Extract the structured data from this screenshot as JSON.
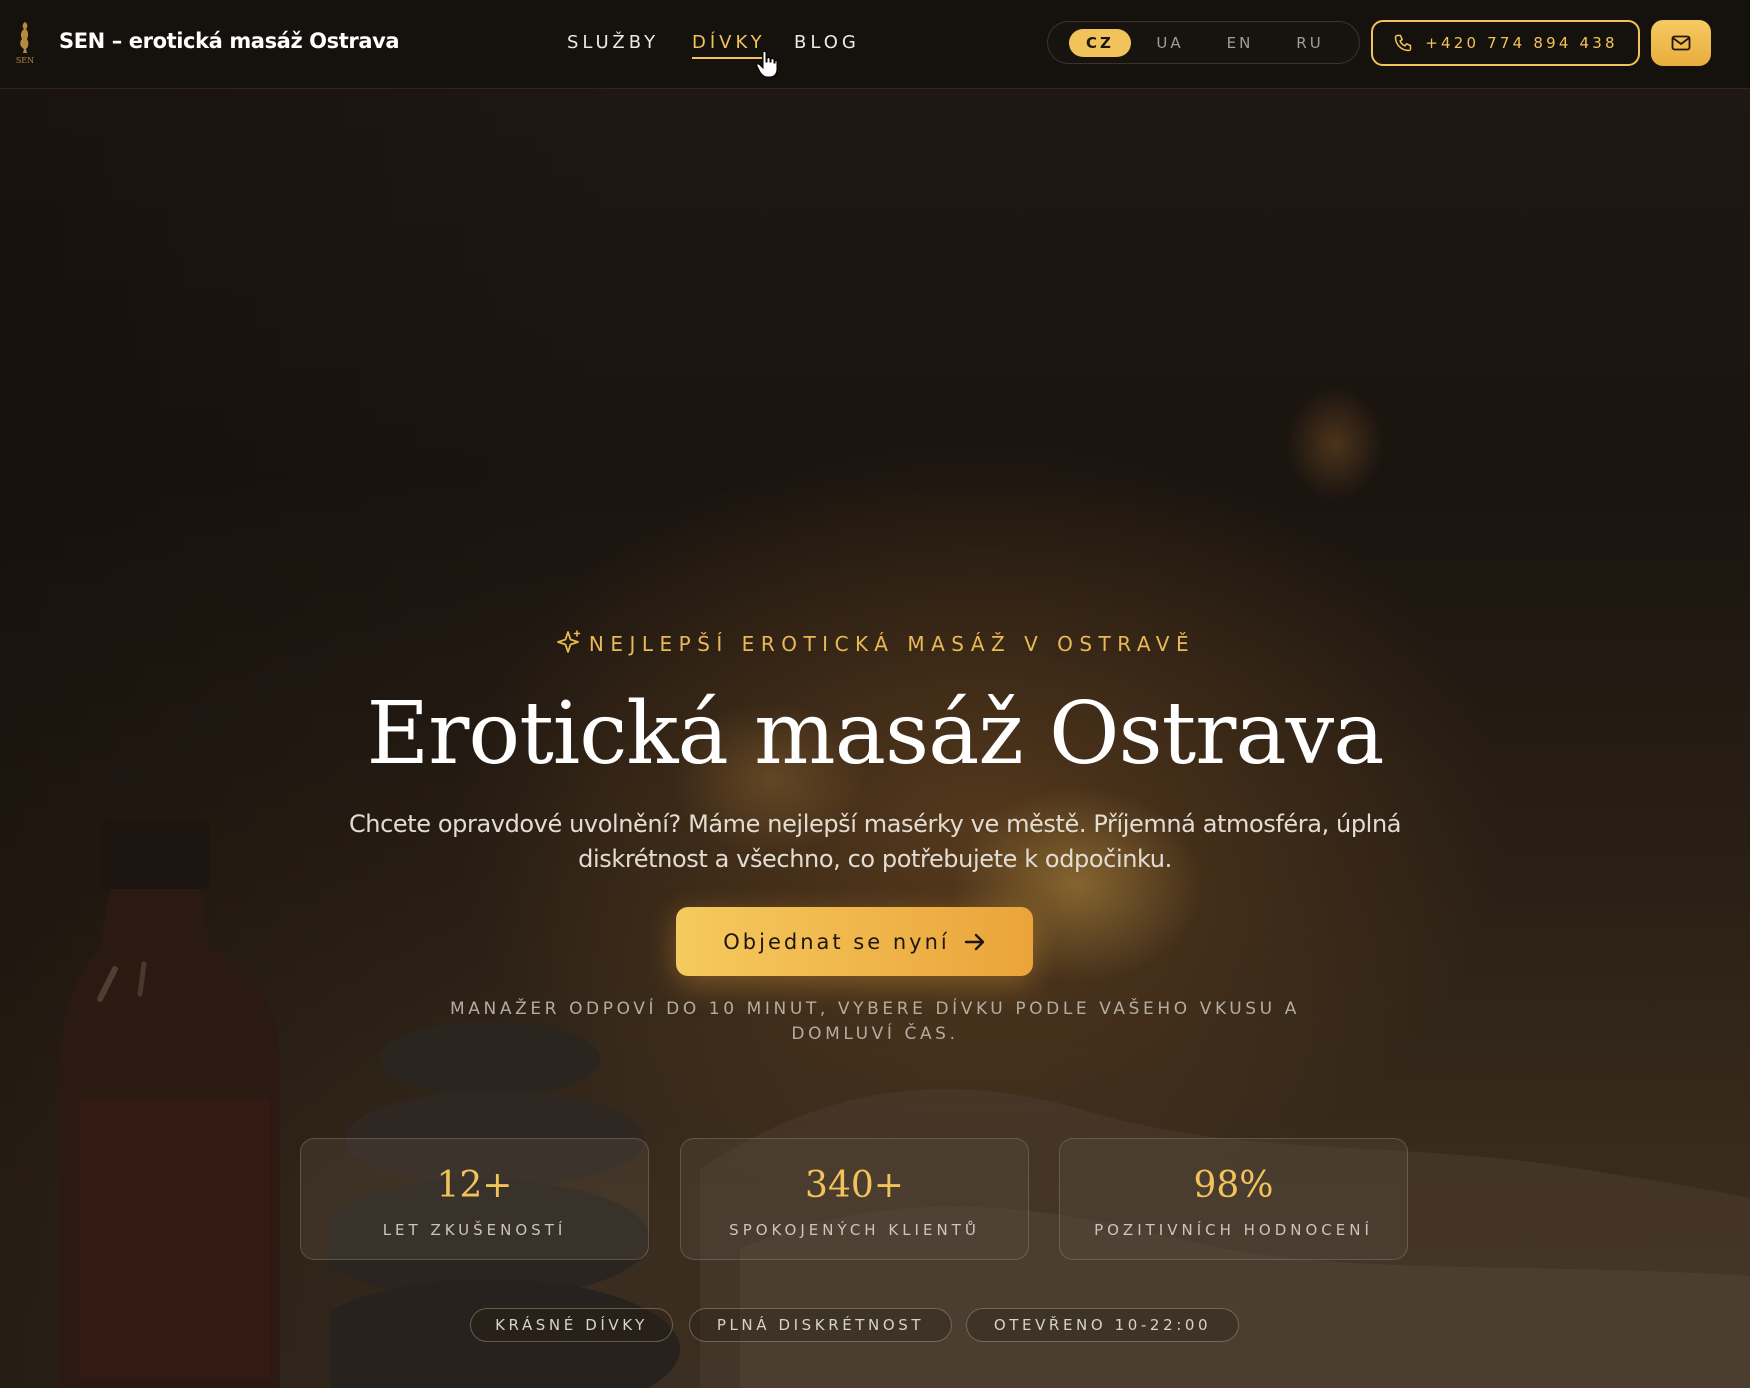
{
  "header": {
    "site_title": "SEN – erotická masáž Ostrava",
    "logo_text": "SEN",
    "nav": [
      {
        "label": "SLUŽBY",
        "active": false
      },
      {
        "label": "DÍVKY",
        "active": true
      },
      {
        "label": "BLOG",
        "active": false
      }
    ],
    "languages": [
      {
        "label": "CZ",
        "active": true
      },
      {
        "label": "UA",
        "active": false
      },
      {
        "label": "EN",
        "active": false
      },
      {
        "label": "RU",
        "active": false
      }
    ],
    "phone": "+420 774 894 438",
    "phone_icon": "phone-icon",
    "mail_icon": "mail-icon"
  },
  "hero": {
    "eyebrow": "NEJLEPŠÍ EROTICKÁ MASÁŽ V OSTRAVĚ",
    "eyebrow_icon": "sparkle-icon",
    "title": "Erotická masáž Ostrava",
    "subtitle": "Chcete opravdové uvolnění? Máme nejlepší masérky ve městě. Příjemná atmosféra, úplná diskrétnost a všechno, co potřebujete k odpočinku.",
    "cta_label": "Objednat se nyní",
    "cta_icon": "arrow-right-icon",
    "note": "MANAŽER ODPOVÍ DO 10 MINUT, VYBERE DÍVKU PODLE VAŠEHO VKUSU A DOMLUVÍ ČAS.",
    "stats": [
      {
        "value": "12+",
        "label": "LET ZKUŠENOSTÍ"
      },
      {
        "value": "340+",
        "label": "SPOKOJENÝCH KLIENTŮ"
      },
      {
        "value": "98%",
        "label": "POZITIVNÍCH HODNOCENÍ"
      }
    ],
    "badges": [
      "KRÁSNÉ DÍVKY",
      "PLNÁ DISKRÉTNOST",
      "OTEVŘENO 10-22:00"
    ]
  },
  "colors": {
    "accent": "#f1c35a",
    "header_bg": "#15110d",
    "text": "#ffffff"
  }
}
